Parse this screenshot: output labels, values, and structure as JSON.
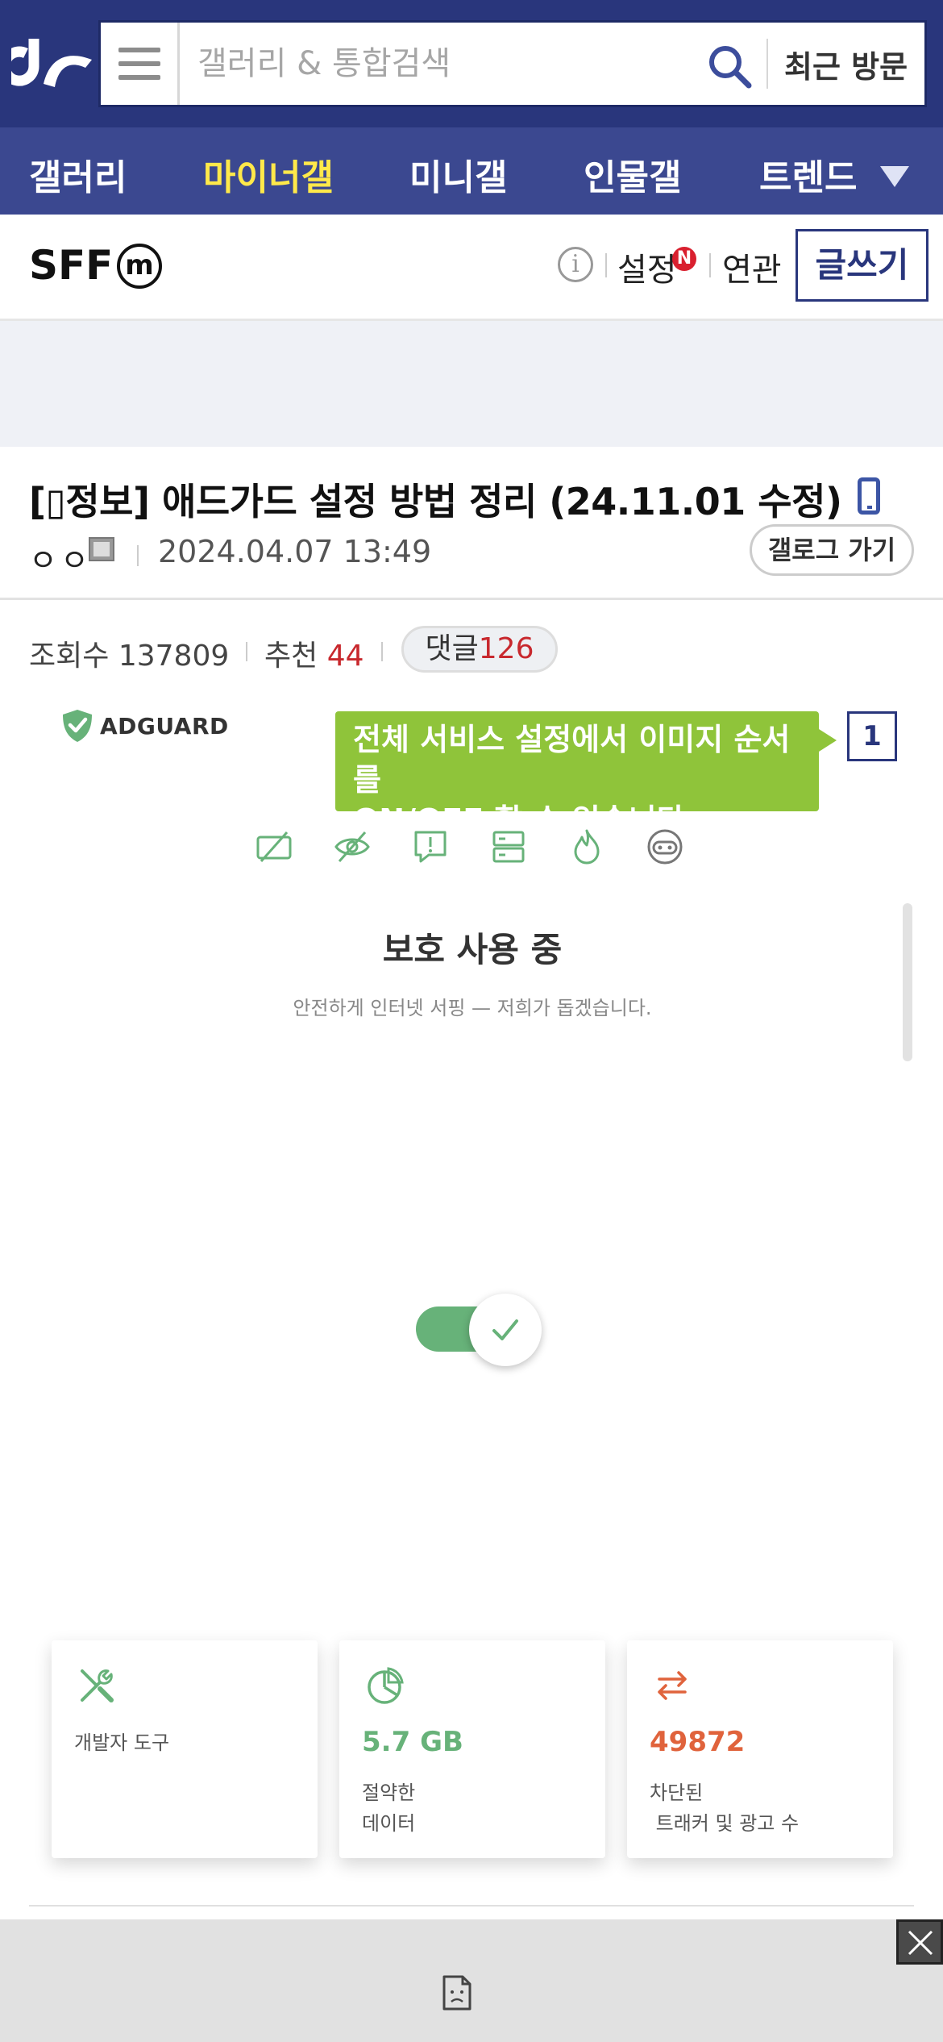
{
  "header": {
    "search_placeholder": "갤러리 & 통합검색",
    "recent_label": "최근 방문"
  },
  "nav": {
    "items": [
      {
        "label": "갤러리",
        "active": false
      },
      {
        "label": "마이너갤",
        "active": true
      },
      {
        "label": "미니갤",
        "active": false
      },
      {
        "label": "인물갤",
        "active": false
      },
      {
        "label": "트렌드",
        "active": false
      }
    ]
  },
  "gallery": {
    "name": "SFF",
    "badge": "m",
    "info_icon": "i",
    "settings_label": "설정",
    "settings_badge": "N",
    "related_label": "연관",
    "write_label": "글쓰기"
  },
  "post": {
    "title": "[▯정보] 애드가드 설정 방법 정리 (24.11.01 수정)",
    "author": "ㅇㅇ",
    "date": "2024.04.07 13:49",
    "gallog_label": "갤로그 가기",
    "views_label": "조회수",
    "views": "137809",
    "recommend_label": "추천",
    "recommend": "44",
    "comments_label": "댓글",
    "comments": "126"
  },
  "embed": {
    "brand": "ADGUARD",
    "tooltip_line1": "전체 서비스 설정에서 이미지 순서를",
    "tooltip_line2": "ON/OFF 할 수 있습니다.",
    "tooltip_number": "1",
    "protection_title": "보호 사용 중",
    "protection_subtitle": "안전하게 인터넷 서핑 — 저희가 돕겠습니다.",
    "toggle_on": true,
    "cards": [
      {
        "label": "개발자 도구",
        "value": "",
        "label2": "",
        "icon": "tools-icon"
      },
      {
        "label": "절약한",
        "label2": "데이터",
        "value": "5.7 GB",
        "icon": "pie-chart-icon"
      },
      {
        "label": "차단된",
        "label2": " 트래커 및 광고 수",
        "value": "49872",
        "icon": "arrows-swap-icon"
      }
    ]
  },
  "colors": {
    "header_bg": "#29367c",
    "nav_bg": "#3b4890",
    "nav_active": "#ffe94a",
    "accent_red": "#c8282d",
    "adguard_green": "#67b279",
    "tooltip_green": "#8fc43a",
    "blocked_orange": "#e0633c"
  }
}
